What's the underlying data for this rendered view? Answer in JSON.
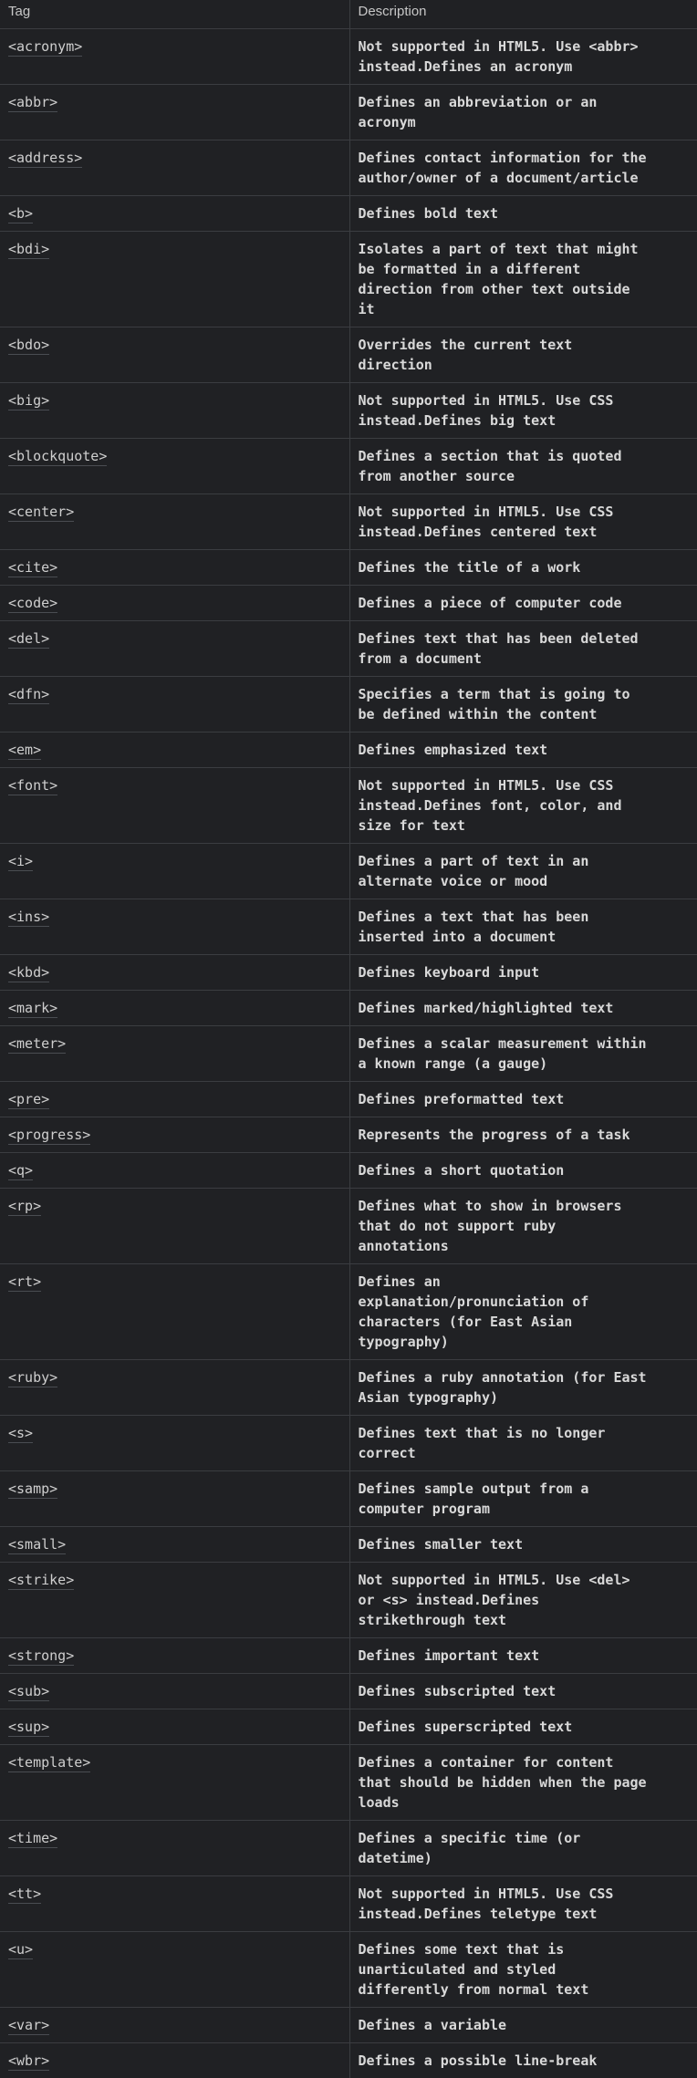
{
  "table": {
    "headers": {
      "tag": "Tag",
      "description": "Description"
    },
    "rows": [
      {
        "tag": "<acronym>",
        "description": "Not supported in HTML5. Use <abbr>\ninstead.Defines an acronym"
      },
      {
        "tag": "<abbr>",
        "description": "Defines an abbreviation or an\nacronym"
      },
      {
        "tag": "<address>",
        "description": "Defines contact information for the\nauthor/owner of a document/article"
      },
      {
        "tag": "<b>",
        "description": "Defines bold text"
      },
      {
        "tag": "<bdi>",
        "description": "Isolates a part of text that might\nbe formatted in a different\ndirection from other text outside\nit"
      },
      {
        "tag": "<bdo>",
        "description": "Overrides the current text\ndirection"
      },
      {
        "tag": "<big>",
        "description": "Not supported in HTML5. Use CSS\ninstead.Defines big text"
      },
      {
        "tag": "<blockquote>",
        "description": "Defines a section that is quoted\nfrom another source"
      },
      {
        "tag": "<center>",
        "description": "Not supported in HTML5. Use CSS\ninstead.Defines centered text"
      },
      {
        "tag": "<cite>",
        "description": "Defines the title of a work"
      },
      {
        "tag": "<code>",
        "description": "Defines a piece of computer code"
      },
      {
        "tag": "<del>",
        "description": "Defines text that has been deleted\nfrom a document"
      },
      {
        "tag": "<dfn>",
        "description": "Specifies a term that is going to\nbe defined within the content"
      },
      {
        "tag": "<em>",
        "description": "Defines emphasized text"
      },
      {
        "tag": "<font>",
        "description": "Not supported in HTML5. Use CSS\ninstead.Defines font, color, and\nsize for text"
      },
      {
        "tag": "<i>",
        "description": "Defines a part of text in an\nalternate voice or mood"
      },
      {
        "tag": "<ins>",
        "description": "Defines a text that has been\ninserted into a document"
      },
      {
        "tag": "<kbd>",
        "description": "Defines keyboard input"
      },
      {
        "tag": "<mark>",
        "description": "Defines marked/highlighted text"
      },
      {
        "tag": "<meter>",
        "description": "Defines a scalar measurement within\na known range (a gauge)"
      },
      {
        "tag": "<pre>",
        "description": "Defines preformatted text"
      },
      {
        "tag": "<progress>",
        "description": "Represents the progress of a task"
      },
      {
        "tag": "<q>",
        "description": "Defines a short quotation"
      },
      {
        "tag": "<rp>",
        "description": "Defines what to show in browsers\nthat do not support ruby\nannotations"
      },
      {
        "tag": "<rt>",
        "description": "Defines an\nexplanation/pronunciation of\ncharacters (for East Asian\ntypography)"
      },
      {
        "tag": "<ruby>",
        "description": "Defines a ruby annotation (for East\nAsian typography)"
      },
      {
        "tag": "<s>",
        "description": "Defines text that is no longer\ncorrect"
      },
      {
        "tag": "<samp>",
        "description": "Defines sample output from a\ncomputer program"
      },
      {
        "tag": "<small>",
        "description": "Defines smaller text"
      },
      {
        "tag": "<strike>",
        "description": "Not supported in HTML5. Use <del>\nor <s> instead.Defines\nstrikethrough text"
      },
      {
        "tag": "<strong>",
        "description": "Defines important text"
      },
      {
        "tag": "<sub>",
        "description": "Defines subscripted text"
      },
      {
        "tag": "<sup>",
        "description": "Defines superscripted text"
      },
      {
        "tag": "<template>",
        "description": "Defines a container for content\nthat should be hidden when the page\nloads"
      },
      {
        "tag": "<time>",
        "description": "Defines a specific time (or\ndatetime)"
      },
      {
        "tag": "<tt>",
        "description": "Not supported in HTML5. Use CSS\ninstead.Defines teletype text"
      },
      {
        "tag": "<u>",
        "description": "Defines some text that is\nunarticulated and styled\ndifferently from normal text"
      },
      {
        "tag": "<var>",
        "description": "Defines a variable"
      },
      {
        "tag": "<wbr>",
        "description": "Defines a possible line-break"
      }
    ]
  }
}
